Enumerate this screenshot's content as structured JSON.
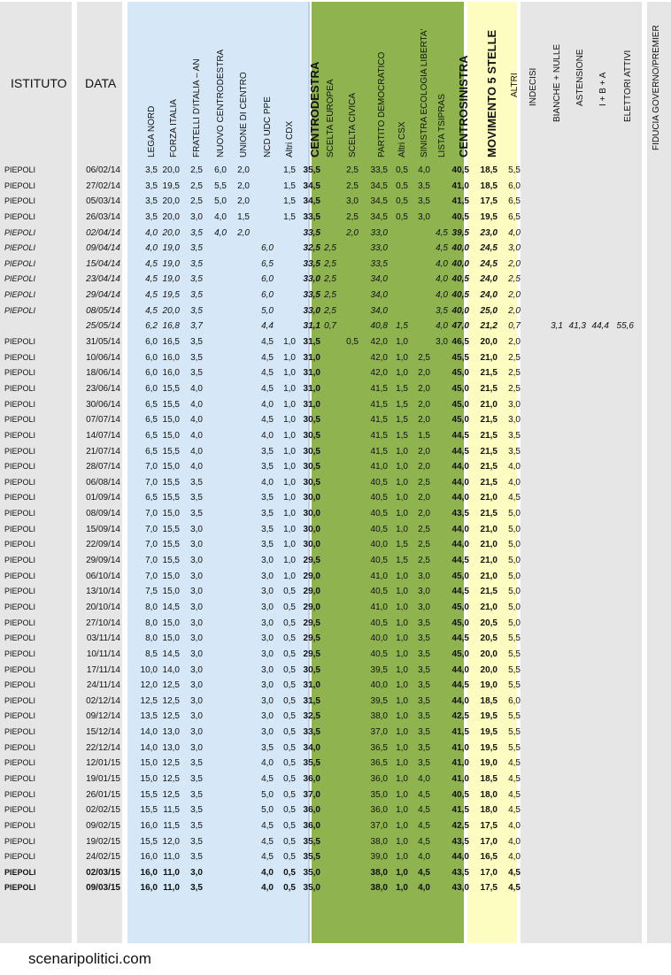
{
  "header": {
    "istituto": "ISTITUTO",
    "data": "DATA",
    "columns": [
      "LEGA NORD",
      "FORZA ITALIA",
      "FRATELLI D'ITALIA – AN",
      "NUOVO CENTRODESTRA",
      "UNIONE DI CENTRO",
      "NCD UDC PPE",
      "Altri CDX",
      "CENTRODESTRA",
      "SCELTA EUROPEA",
      "SCELTA CIVICA",
      "PARTITO DEMOCRATICO",
      "Altri CSX",
      "SINISTRA ECOLOGIA LIBERTA'",
      "LISTA TSIPRAS",
      "CENTROSINISTRA",
      "MOVIMENTO 5 STELLE",
      "ALTRI",
      "INDECISI",
      "BIANCHE + NULLE",
      "ASTENSIONE",
      "I + B + A",
      "ELETTORI ATTIVI",
      "FIDUCIA GOVERNO/PREMIER"
    ]
  },
  "rows": [
    {
      "ist": "PIEPOLI",
      "date": "06/02/14",
      "v": [
        "3,5",
        "20,0",
        "2,5",
        "6,0",
        "2,0",
        "",
        "1,5",
        "35,5",
        "",
        "2,5",
        "33,5",
        "0,5",
        "4,0",
        "",
        "40,5",
        "18,5",
        "5,5",
        "",
        "",
        "",
        "",
        "",
        ""
      ]
    },
    {
      "ist": "PIEPOLI",
      "date": "27/02/14",
      "v": [
        "3,5",
        "19,5",
        "2,5",
        "5,5",
        "2,0",
        "",
        "1,5",
        "34,5",
        "",
        "2,5",
        "34,5",
        "0,5",
        "3,5",
        "",
        "41,0",
        "18,5",
        "6,0",
        "",
        "",
        "",
        "",
        "",
        ""
      ]
    },
    {
      "ist": "PIEPOLI",
      "date": "05/03/14",
      "v": [
        "3,5",
        "20,0",
        "2,5",
        "5,0",
        "2,0",
        "",
        "1,5",
        "34,5",
        "",
        "3,0",
        "34,5",
        "0,5",
        "3,5",
        "",
        "41,5",
        "17,5",
        "6,5",
        "",
        "",
        "",
        "",
        "",
        ""
      ]
    },
    {
      "ist": "PIEPOLI",
      "date": "26/03/14",
      "v": [
        "3,5",
        "20,0",
        "3,0",
        "4,0",
        "1,5",
        "",
        "1,5",
        "33,5",
        "",
        "2,5",
        "34,5",
        "0,5",
        "3,0",
        "",
        "40,5",
        "19,5",
        "6,5",
        "",
        "",
        "",
        "",
        "",
        ""
      ]
    },
    {
      "ist": "PIEPOLI",
      "date": "02/04/14",
      "style": "italic",
      "v": [
        "4,0",
        "20,0",
        "3,5",
        "4,0",
        "2,0",
        "",
        "",
        "33,5",
        "",
        "2,0",
        "33,0",
        "",
        "",
        "4,5",
        "39,5",
        "23,0",
        "4,0",
        "",
        "",
        "",
        "",
        "",
        ""
      ]
    },
    {
      "ist": "PIEPOLI",
      "date": "09/04/14",
      "style": "italic",
      "v": [
        "4,0",
        "19,0",
        "3,5",
        "",
        "",
        "6,0",
        "",
        "32,5",
        "2,5",
        "",
        "33,0",
        "",
        "",
        "4,5",
        "40,0",
        "24,5",
        "3,0",
        "",
        "",
        "",
        "",
        "",
        ""
      ]
    },
    {
      "ist": "PIEPOLI",
      "date": "15/04/14",
      "style": "italic",
      "v": [
        "4,5",
        "19,0",
        "3,5",
        "",
        "",
        "6,5",
        "",
        "33,5",
        "2,5",
        "",
        "33,5",
        "",
        "",
        "4,0",
        "40,0",
        "24,5",
        "2,0",
        "",
        "",
        "",
        "",
        "",
        ""
      ]
    },
    {
      "ist": "PIEPOLI",
      "date": "23/04/14",
      "style": "italic",
      "v": [
        "4,5",
        "19,0",
        "3,5",
        "",
        "",
        "6,0",
        "",
        "33,0",
        "2,5",
        "",
        "34,0",
        "",
        "",
        "4,0",
        "40,5",
        "24,0",
        "2,5",
        "",
        "",
        "",
        "",
        "",
        ""
      ]
    },
    {
      "ist": "PIEPOLI",
      "date": "29/04/14",
      "style": "italic",
      "v": [
        "4,5",
        "19,5",
        "3,5",
        "",
        "",
        "6,0",
        "",
        "33,5",
        "2,5",
        "",
        "34,0",
        "",
        "",
        "4,0",
        "40,5",
        "24,0",
        "2,0",
        "",
        "",
        "",
        "",
        "",
        ""
      ]
    },
    {
      "ist": "PIEPOLI",
      "date": "08/05/14",
      "style": "italic",
      "v": [
        "4,5",
        "20,0",
        "3,5",
        "",
        "",
        "5,0",
        "",
        "33,0",
        "2,5",
        "",
        "34,0",
        "",
        "",
        "3,5",
        "40,0",
        "25,0",
        "2,0",
        "",
        "",
        "",
        "",
        "",
        ""
      ]
    },
    {
      "ist": "",
      "date": "25/05/14",
      "style": "italic",
      "v": [
        "6,2",
        "16,8",
        "3,7",
        "",
        "",
        "4,4",
        "",
        "31,1",
        "0,7",
        "",
        "40,8",
        "1,5",
        "",
        "4,0",
        "47,0",
        "21,2",
        "0,7",
        "",
        "3,1",
        "41,3",
        "44,4",
        "55,6",
        ""
      ]
    },
    {
      "ist": "PIEPOLI",
      "date": "31/05/14",
      "v": [
        "6,0",
        "16,5",
        "3,5",
        "",
        "",
        "4,5",
        "1,0",
        "31,5",
        "",
        "0,5",
        "42,0",
        "1,0",
        "",
        "3,0",
        "46,5",
        "20,0",
        "2,0",
        "",
        "",
        "",
        "",
        "",
        ""
      ]
    },
    {
      "ist": "PIEPOLI",
      "date": "10/06/14",
      "v": [
        "6,0",
        "16,0",
        "3,5",
        "",
        "",
        "4,5",
        "1,0",
        "31,0",
        "",
        "",
        "42,0",
        "1,0",
        "2,5",
        "",
        "45,5",
        "21,0",
        "2,5",
        "",
        "",
        "",
        "",
        "",
        ""
      ]
    },
    {
      "ist": "PIEPOLI",
      "date": "18/06/14",
      "v": [
        "6,0",
        "16,0",
        "3,5",
        "",
        "",
        "4,5",
        "1,0",
        "31,0",
        "",
        "",
        "42,0",
        "1,0",
        "2,0",
        "",
        "45,0",
        "21,5",
        "2,5",
        "",
        "",
        "",
        "",
        "",
        ""
      ]
    },
    {
      "ist": "PIEPOLI",
      "date": "23/06/14",
      "v": [
        "6,0",
        "15,5",
        "4,0",
        "",
        "",
        "4,5",
        "1,0",
        "31,0",
        "",
        "",
        "41,5",
        "1,5",
        "2,0",
        "",
        "45,0",
        "21,5",
        "2,5",
        "",
        "",
        "",
        "",
        "",
        ""
      ]
    },
    {
      "ist": "PIEPOLI",
      "date": "30/06/14",
      "v": [
        "6,5",
        "15,5",
        "4,0",
        "",
        "",
        "4,0",
        "1,0",
        "31,0",
        "",
        "",
        "41,5",
        "1,5",
        "2,0",
        "",
        "45,0",
        "21,0",
        "3,0",
        "",
        "",
        "",
        "",
        "",
        ""
      ]
    },
    {
      "ist": "PIEPOLI",
      "date": "07/07/14",
      "v": [
        "6,5",
        "15,0",
        "4,0",
        "",
        "",
        "4,5",
        "1,0",
        "30,5",
        "",
        "",
        "41,5",
        "1,5",
        "2,0",
        "",
        "45,0",
        "21,5",
        "3,0",
        "",
        "",
        "",
        "",
        "",
        ""
      ]
    },
    {
      "ist": "PIEPOLI",
      "date": "14/07/14",
      "v": [
        "6,5",
        "15,0",
        "4,0",
        "",
        "",
        "4,0",
        "1,0",
        "30,5",
        "",
        "",
        "41,5",
        "1,5",
        "1,5",
        "",
        "44,5",
        "21,5",
        "3,5",
        "",
        "",
        "",
        "",
        "",
        ""
      ]
    },
    {
      "ist": "PIEPOLI",
      "date": "21/07/14",
      "v": [
        "6,5",
        "15,5",
        "4,0",
        "",
        "",
        "3,5",
        "1,0",
        "30,5",
        "",
        "",
        "41,5",
        "1,0",
        "2,0",
        "",
        "44,5",
        "21,5",
        "3,5",
        "",
        "",
        "",
        "",
        "",
        ""
      ]
    },
    {
      "ist": "PIEPOLI",
      "date": "28/07/14",
      "v": [
        "7,0",
        "15,0",
        "4,0",
        "",
        "",
        "3,5",
        "1,0",
        "30,5",
        "",
        "",
        "41,0",
        "1,0",
        "2,0",
        "",
        "44,0",
        "21,5",
        "4,0",
        "",
        "",
        "",
        "",
        "",
        ""
      ]
    },
    {
      "ist": "PIEPOLI",
      "date": "06/08/14",
      "v": [
        "7,0",
        "15,5",
        "3,5",
        "",
        "",
        "4,0",
        "1,0",
        "30,5",
        "",
        "",
        "40,5",
        "1,0",
        "2,5",
        "",
        "44,0",
        "21,5",
        "4,0",
        "",
        "",
        "",
        "",
        "",
        ""
      ]
    },
    {
      "ist": "PIEPOLI",
      "date": "01/09/14",
      "v": [
        "6,5",
        "15,5",
        "3,5",
        "",
        "",
        "3,5",
        "1,0",
        "30,0",
        "",
        "",
        "40,5",
        "1,0",
        "2,0",
        "",
        "44,0",
        "21,0",
        "4,5",
        "",
        "",
        "",
        "",
        "",
        ""
      ]
    },
    {
      "ist": "PIEPOLI",
      "date": "08/09/14",
      "v": [
        "7,0",
        "15,0",
        "3,5",
        "",
        "",
        "3,5",
        "1,0",
        "30,0",
        "",
        "",
        "40,5",
        "1,0",
        "2,0",
        "",
        "43,5",
        "21,5",
        "5,0",
        "",
        "",
        "",
        "",
        "",
        ""
      ]
    },
    {
      "ist": "PIEPOLI",
      "date": "15/09/14",
      "v": [
        "7,0",
        "15,5",
        "3,0",
        "",
        "",
        "3,5",
        "1,0",
        "30,0",
        "",
        "",
        "40,5",
        "1,0",
        "2,5",
        "",
        "44,0",
        "21,0",
        "5,0",
        "",
        "",
        "",
        "",
        "",
        ""
      ]
    },
    {
      "ist": "PIEPOLI",
      "date": "22/09/14",
      "v": [
        "7,0",
        "15,5",
        "3,0",
        "",
        "",
        "3,5",
        "1,0",
        "30,0",
        "",
        "",
        "40,0",
        "1,5",
        "2,5",
        "",
        "44,0",
        "21,0",
        "5,0",
        "",
        "",
        "",
        "",
        "",
        ""
      ]
    },
    {
      "ist": "PIEPOLI",
      "date": "29/09/14",
      "v": [
        "7,0",
        "15,5",
        "3,0",
        "",
        "",
        "3,0",
        "1,0",
        "29,5",
        "",
        "",
        "40,5",
        "1,5",
        "2,5",
        "",
        "44,5",
        "21,0",
        "5,0",
        "",
        "",
        "",
        "",
        "",
        ""
      ]
    },
    {
      "ist": "PIEPOLI",
      "date": "06/10/14",
      "v": [
        "7,0",
        "15,0",
        "3,0",
        "",
        "",
        "3,0",
        "1,0",
        "29,0",
        "",
        "",
        "41,0",
        "1,0",
        "3,0",
        "",
        "45,0",
        "21,0",
        "5,0",
        "",
        "",
        "",
        "",
        "",
        ""
      ]
    },
    {
      "ist": "PIEPOLI",
      "date": "13/10/14",
      "v": [
        "7,5",
        "15,0",
        "3,0",
        "",
        "",
        "3,0",
        "0,5",
        "29,0",
        "",
        "",
        "40,5",
        "1,0",
        "3,0",
        "",
        "44,5",
        "21,5",
        "5,0",
        "",
        "",
        "",
        "",
        "",
        ""
      ]
    },
    {
      "ist": "PIEPOLI",
      "date": "20/10/14",
      "v": [
        "8,0",
        "14,5",
        "3,0",
        "",
        "",
        "3,0",
        "0,5",
        "29,0",
        "",
        "",
        "41,0",
        "1,0",
        "3,0",
        "",
        "45,0",
        "21,0",
        "5,0",
        "",
        "",
        "",
        "",
        "",
        ""
      ]
    },
    {
      "ist": "PIEPOLI",
      "date": "27/10/14",
      "v": [
        "8,0",
        "15,0",
        "3,0",
        "",
        "",
        "3,0",
        "0,5",
        "29,5",
        "",
        "",
        "40,5",
        "1,0",
        "3,5",
        "",
        "45,0",
        "20,5",
        "5,0",
        "",
        "",
        "",
        "",
        "",
        ""
      ]
    },
    {
      "ist": "PIEPOLI",
      "date": "03/11/14",
      "v": [
        "8,0",
        "15,0",
        "3,0",
        "",
        "",
        "3,0",
        "0,5",
        "29,5",
        "",
        "",
        "40,0",
        "1,0",
        "3,5",
        "",
        "44,5",
        "20,5",
        "5,5",
        "",
        "",
        "",
        "",
        "",
        ""
      ]
    },
    {
      "ist": "PIEPOLI",
      "date": "10/11/14",
      "v": [
        "8,5",
        "14,5",
        "3,0",
        "",
        "",
        "3,0",
        "0,5",
        "29,5",
        "",
        "",
        "40,5",
        "1,0",
        "3,5",
        "",
        "45,0",
        "20,0",
        "5,5",
        "",
        "",
        "",
        "",
        "",
        ""
      ]
    },
    {
      "ist": "PIEPOLI",
      "date": "17/11/14",
      "v": [
        "10,0",
        "14,0",
        "3,0",
        "",
        "",
        "3,0",
        "0,5",
        "30,5",
        "",
        "",
        "39,5",
        "1,0",
        "3,5",
        "",
        "44,0",
        "20,0",
        "5,5",
        "",
        "",
        "",
        "",
        "",
        ""
      ]
    },
    {
      "ist": "PIEPOLI",
      "date": "24/11/14",
      "v": [
        "12,0",
        "12,5",
        "3,0",
        "",
        "",
        "3,0",
        "0,5",
        "31,0",
        "",
        "",
        "40,0",
        "1,0",
        "3,5",
        "",
        "44,5",
        "19,0",
        "5,5",
        "",
        "",
        "",
        "",
        "",
        ""
      ]
    },
    {
      "ist": "PIEPOLI",
      "date": "02/12/14",
      "v": [
        "12,5",
        "12,5",
        "3,0",
        "",
        "",
        "3,0",
        "0,5",
        "31,5",
        "",
        "",
        "39,5",
        "1,0",
        "3,5",
        "",
        "44,0",
        "18,5",
        "6,0",
        "",
        "",
        "",
        "",
        "",
        ""
      ]
    },
    {
      "ist": "PIEPOLI",
      "date": "09/12/14",
      "v": [
        "13,5",
        "12,5",
        "3,0",
        "",
        "",
        "3,0",
        "0,5",
        "32,5",
        "",
        "",
        "38,0",
        "1,0",
        "3,5",
        "",
        "42,5",
        "19,5",
        "5,5",
        "",
        "",
        "",
        "",
        "",
        ""
      ]
    },
    {
      "ist": "PIEPOLI",
      "date": "15/12/14",
      "v": [
        "14,0",
        "13,0",
        "3,0",
        "",
        "",
        "3,0",
        "0,5",
        "33,5",
        "",
        "",
        "37,0",
        "1,0",
        "3,5",
        "",
        "41,5",
        "19,5",
        "5,5",
        "",
        "",
        "",
        "",
        "",
        ""
      ]
    },
    {
      "ist": "PIEPOLI",
      "date": "22/12/14",
      "v": [
        "14,0",
        "13,0",
        "3,0",
        "",
        "",
        "3,5",
        "0,5",
        "34,0",
        "",
        "",
        "36,5",
        "1,0",
        "3,5",
        "",
        "41,0",
        "19,5",
        "5,5",
        "",
        "",
        "",
        "",
        "",
        ""
      ]
    },
    {
      "ist": "PIEPOLI",
      "date": "12/01/15",
      "v": [
        "15,0",
        "12,5",
        "3,5",
        "",
        "",
        "4,0",
        "0,5",
        "35,5",
        "",
        "",
        "36,5",
        "1,0",
        "3,5",
        "",
        "41,0",
        "19,0",
        "4,5",
        "",
        "",
        "",
        "",
        "",
        ""
      ]
    },
    {
      "ist": "PIEPOLI",
      "date": "19/01/15",
      "v": [
        "15,0",
        "12,5",
        "3,5",
        "",
        "",
        "4,5",
        "0,5",
        "36,0",
        "",
        "",
        "36,0",
        "1,0",
        "4,0",
        "",
        "41,0",
        "18,5",
        "4,5",
        "",
        "",
        "",
        "",
        "",
        ""
      ]
    },
    {
      "ist": "PIEPOLI",
      "date": "26/01/15",
      "v": [
        "15,5",
        "12,5",
        "3,5",
        "",
        "",
        "5,0",
        "0,5",
        "37,0",
        "",
        "",
        "35,0",
        "1,0",
        "4,5",
        "",
        "40,5",
        "18,0",
        "4,5",
        "",
        "",
        "",
        "",
        "",
        ""
      ]
    },
    {
      "ist": "PIEPOLI",
      "date": "02/02/15",
      "v": [
        "15,5",
        "11,5",
        "3,5",
        "",
        "",
        "5,0",
        "0,5",
        "36,0",
        "",
        "",
        "36,0",
        "1,0",
        "4,5",
        "",
        "41,5",
        "18,0",
        "4,5",
        "",
        "",
        "",
        "",
        "",
        ""
      ]
    },
    {
      "ist": "PIEPOLI",
      "date": "09/02/15",
      "v": [
        "16,0",
        "11,5",
        "3,5",
        "",
        "",
        "4,5",
        "0,5",
        "36,0",
        "",
        "",
        "37,0",
        "1,0",
        "4,5",
        "",
        "42,5",
        "17,5",
        "4,0",
        "",
        "",
        "",
        "",
        "",
        ""
      ]
    },
    {
      "ist": "PIEPOLI",
      "date": "19/02/15",
      "v": [
        "15,5",
        "12,0",
        "3,5",
        "",
        "",
        "4,5",
        "0,5",
        "35,5",
        "",
        "",
        "38,0",
        "1,0",
        "4,5",
        "",
        "43,5",
        "17,0",
        "4,0",
        "",
        "",
        "",
        "",
        "",
        ""
      ]
    },
    {
      "ist": "PIEPOLI",
      "date": "24/02/15",
      "v": [
        "16,0",
        "11,0",
        "3,5",
        "",
        "",
        "4,5",
        "0,5",
        "35,5",
        "",
        "",
        "39,0",
        "1,0",
        "4,0",
        "",
        "44,0",
        "16,5",
        "4,0",
        "",
        "",
        "",
        "",
        "",
        ""
      ]
    },
    {
      "ist": "PIEPOLI",
      "date": "02/03/15",
      "style": "bold",
      "v": [
        "16,0",
        "11,0",
        "3,0",
        "",
        "",
        "4,0",
        "0,5",
        "35,0",
        "",
        "",
        "38,0",
        "1,0",
        "4,5",
        "",
        "43,5",
        "17,0",
        "4,5",
        "",
        "",
        "",
        "",
        "",
        ""
      ]
    },
    {
      "ist": "PIEPOLI",
      "date": "09/03/15",
      "style": "bold",
      "v": [
        "16,0",
        "11,0",
        "3,5",
        "",
        "",
        "4,0",
        "0,5",
        "35,0",
        "",
        "",
        "38,0",
        "1,0",
        "4,0",
        "",
        "43,0",
        "17,5",
        "4,5",
        "",
        "",
        "",
        "",
        "",
        ""
      ]
    }
  ],
  "footer": "scenaripolitici.com"
}
